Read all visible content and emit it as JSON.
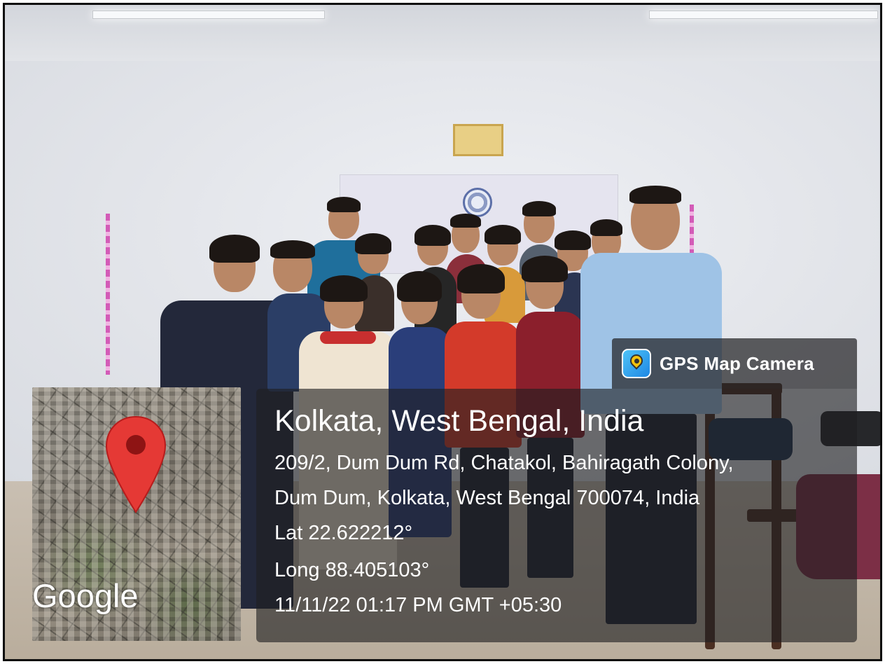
{
  "overlay": {
    "app_name": "GPS Map Camera",
    "app_icon": "gps-map-camera-icon",
    "location_title": "Kolkata, West Bengal, India",
    "address_line_1": "209/2, Dum Dum Rd, Chatakol, Bahiragath Colony,",
    "address_line_2": "Dum Dum, Kolkata, West Bengal 700074, India",
    "latitude": "Lat 22.622212°",
    "longitude": "Long 88.405103°",
    "timestamp": "11/11/22 01:17 PM GMT +05:30"
  },
  "map": {
    "provider_label": "Google",
    "pin_icon": "map-pin-icon",
    "pin_color": "#e53935"
  }
}
